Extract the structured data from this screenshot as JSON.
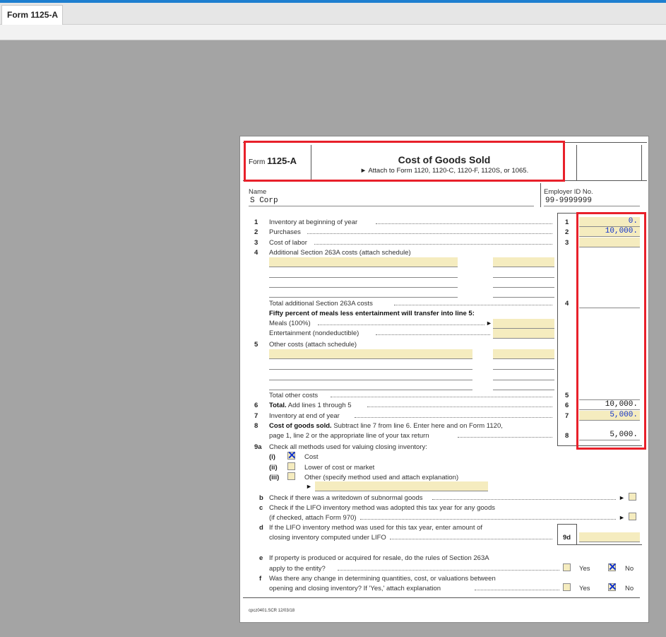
{
  "tab": {
    "label": "Form 1125-A"
  },
  "header": {
    "form_word": "Form",
    "form_number": "1125-A",
    "title": "Cost of Goods Sold",
    "attach_arrow": "►",
    "attach_text": "Attach to Form 1120, 1120-C, 1120-F, 1120S, or 1065."
  },
  "name": {
    "label": "Name",
    "value": "S Corp"
  },
  "ein": {
    "label": "Employer ID No.",
    "value": "99-9999999"
  },
  "lines": {
    "l1": {
      "num": "1",
      "text": "Inventory at beginning of year",
      "box": "1",
      "value": "0."
    },
    "l2": {
      "num": "2",
      "text": "Purchases",
      "box": "2",
      "value": "10,000."
    },
    "l3": {
      "num": "3",
      "text": "Cost of labor",
      "box": "3",
      "value": ""
    },
    "l4": {
      "num": "4",
      "text": "Additional Section 263A costs (attach schedule)",
      "total_text": "Total additional Section 263A costs",
      "box": "4"
    },
    "meals": {
      "bold_text": "Fifty percent of meals less entertainment will transfer into line 5:",
      "meals_text": "Meals (100%)",
      "arrow": "►",
      "ent_text": "Entertainment (nondeductible)"
    },
    "l5": {
      "num": "5",
      "text": "Other costs (attach schedule)",
      "total_text": "Total other costs",
      "box": "5"
    },
    "l6": {
      "num": "6",
      "bold": "Total.",
      "text": "Add lines 1 through 5",
      "box": "6",
      "value": "10,000."
    },
    "l7": {
      "num": "7",
      "text": "Inventory at end of year",
      "box": "7",
      "value": "5,000."
    },
    "l8": {
      "num": "8",
      "bold": "Cost of goods sold.",
      "text": "Subtract line 7 from line 6. Enter here and on Form 1120,",
      "text2": "page 1, line 2 or the appropriate line of your tax return",
      "box": "8",
      "value": "5,000."
    },
    "l9a": {
      "num": "9a",
      "text": "Check all methods used for valuing closing inventory:",
      "options": [
        {
          "roman": "(i)",
          "label": "Cost",
          "checked": true
        },
        {
          "roman": "(ii)",
          "label": "Lower of cost or market",
          "checked": false
        },
        {
          "roman": "(iii)",
          "label": "Other (specify method used and attach explanation)",
          "checked": false
        }
      ],
      "other_arrow": "►"
    },
    "l9b": {
      "num": "b",
      "text": "Check if there was a writedown of subnormal goods",
      "arrow": "►"
    },
    "l9c": {
      "num": "c",
      "text": "Check if the LIFO inventory method was adopted this tax year for any goods",
      "text2": "(if checked, attach Form 970)",
      "arrow": "►"
    },
    "l9d": {
      "num": "d",
      "text": "If the LIFO inventory method was used for this tax year, enter amount of",
      "text2": "closing inventory computed under LIFO",
      "box": "9d"
    },
    "l9e": {
      "num": "e",
      "text": "If property is produced or acquired for resale, do the rules of Section 263A",
      "text2": "apply to the entity?",
      "yes": "Yes",
      "no": "No",
      "answer": "No"
    },
    "l9f": {
      "num": "f",
      "text": "Was there any change in determining quantities, cost, or valuations between",
      "text2": "opening and closing inventory? If 'Yes,' attach explanation",
      "yes": "Yes",
      "no": "No",
      "answer": "No"
    }
  },
  "footer": {
    "code": "cpcz0401.SCR   12/03/18"
  },
  "colors": {
    "highlight_red": "#e8202a",
    "field_fill": "#f5ecbf",
    "checkmark_blue": "#1133cc",
    "tab_accent": "#1e7fd0"
  }
}
